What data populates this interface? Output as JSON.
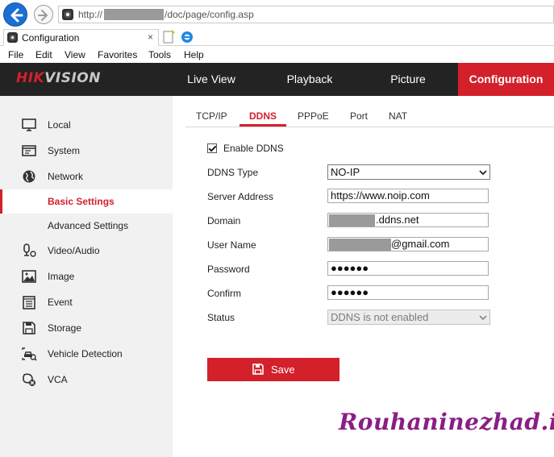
{
  "browser": {
    "url_prefix": "http://",
    "url_path": "/doc/page/config.asp",
    "tab_title": "Configuration",
    "tab_close": "×"
  },
  "menu": [
    "File",
    "Edit",
    "View",
    "Favorites",
    "Tools",
    "Help"
  ],
  "header": {
    "logo_red": "HIK",
    "logo_gray": "VISION",
    "nav": [
      {
        "label": "Live View"
      },
      {
        "label": "Playback"
      },
      {
        "label": "Picture"
      },
      {
        "label": "Configuration"
      }
    ]
  },
  "sidebar": {
    "items": [
      {
        "label": "Local",
        "icon": "monitor-icon"
      },
      {
        "label": "System",
        "icon": "system-icon"
      },
      {
        "label": "Network",
        "icon": "globe-icon"
      },
      {
        "label": "Basic Settings"
      },
      {
        "label": "Advanced Settings"
      },
      {
        "label": "Video/Audio",
        "icon": "microphone-icon"
      },
      {
        "label": "Image",
        "icon": "image-icon"
      },
      {
        "label": "Event",
        "icon": "calendar-icon"
      },
      {
        "label": "Storage",
        "icon": "floppy-icon"
      },
      {
        "label": "Vehicle Detection",
        "icon": "vehicle-detection-icon"
      },
      {
        "label": "VCA",
        "icon": "vca-icon"
      }
    ]
  },
  "subtabs": [
    "TCP/IP",
    "DDNS",
    "PPPoE",
    "Port",
    "NAT"
  ],
  "form": {
    "enable_ddns": "Enable DDNS",
    "ddns_type_label": "DDNS Type",
    "ddns_type_value": "NO-IP",
    "server_address_label": "Server Address",
    "server_address_value": "https://www.noip.com",
    "domain_label": "Domain",
    "domain_suffix": ".ddns.net",
    "user_name_label": "User Name",
    "user_name_suffix": "@gmail.com",
    "password_label": "Password",
    "password_value": "●●●●●●",
    "confirm_label": "Confirm",
    "confirm_value": "●●●●●●",
    "status_label": "Status",
    "status_value": "DDNS is not enabled",
    "save_label": "Save"
  },
  "watermark": "Rouhaninezhad.ir",
  "colors": {
    "accent": "#d3202b",
    "header_bg": "#232323",
    "sidebar_bg": "#f1f1f1",
    "watermark": "#8a1e86"
  }
}
